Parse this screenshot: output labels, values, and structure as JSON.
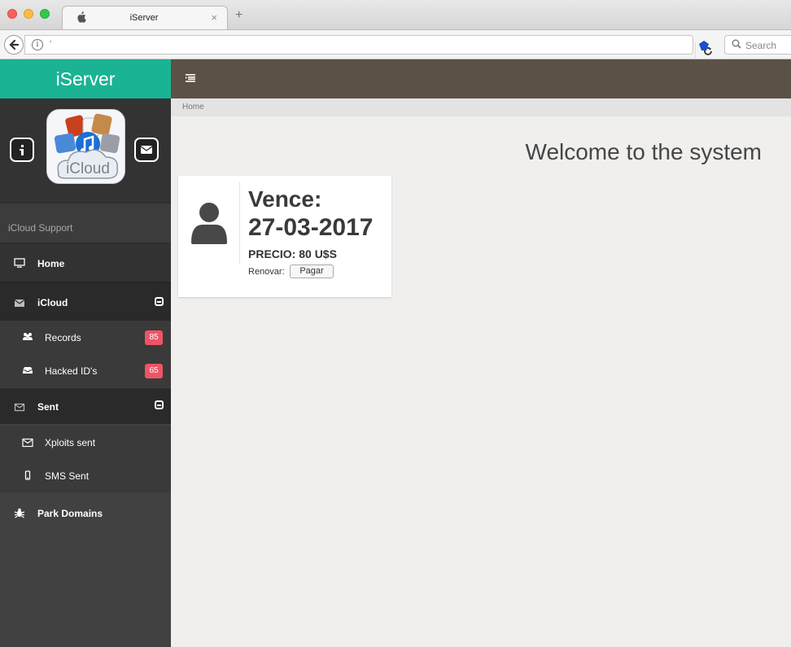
{
  "browser": {
    "tab_title": "iServer",
    "tab_close": "×",
    "new_tab": "+",
    "url_text": "‘",
    "search_placeholder": "Search"
  },
  "sidebar": {
    "brand": "iServer",
    "app_icon_label": "iCloud",
    "support_label": "iCloud Support",
    "nav": {
      "home": "Home",
      "icloud": "iCloud",
      "records": "Records",
      "records_badge": "85",
      "hacked_ids": "Hacked ID's",
      "hacked_badge": "65",
      "sent": "Sent",
      "xploits_sent": "Xploits sent",
      "sms_sent": "SMS Sent",
      "park_domains": "Park Domains"
    }
  },
  "breadcrumb": "Home",
  "main": {
    "welcome": "Welcome to the system",
    "card": {
      "vence_label": "Vence:",
      "vence_date": "27-03-2017",
      "precio": "PRECIO: 80 U$S",
      "renovar_label": "Renovar:",
      "pagar_button": "Pagar"
    }
  },
  "colors": {
    "brand_green": "#1ab394",
    "topnav_brown": "#5b5146",
    "badge_red": "#ed5565",
    "sidebar_dark": "#414141"
  }
}
